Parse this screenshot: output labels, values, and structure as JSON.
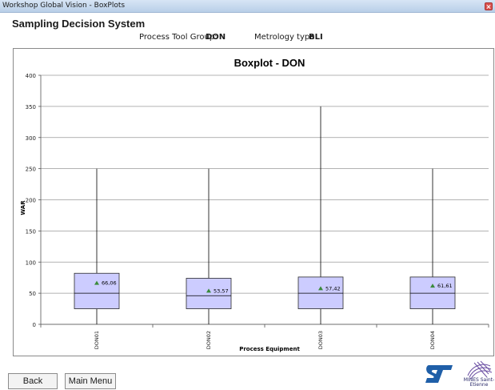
{
  "window": {
    "title": "Workshop Global Vision - BoxPlots"
  },
  "app": {
    "title": "Sampling Decision System"
  },
  "info": {
    "tool_group_label": "Process Tool Group:",
    "tool_group_value": "DON",
    "metrology_label": "Metrology type:",
    "metrology_value": "BLI"
  },
  "buttons": {
    "back": "Back",
    "main_menu": "Main Menu"
  },
  "logos": {
    "st": "ST",
    "mines": "MINES Saint-Etienne"
  },
  "colors": {
    "box_fill": "#ccccff",
    "mean_marker": "#3a8a3a",
    "grid": "#9a9a9a"
  },
  "chart_data": {
    "type": "boxplot",
    "title": "Boxplot - DON",
    "xlabel": "Process Equipment",
    "ylabel": "WAR",
    "ylim": [
      0,
      400
    ],
    "yticks": [
      0,
      50,
      100,
      150,
      200,
      250,
      300,
      350,
      400
    ],
    "grid": true,
    "categories": [
      "DON01",
      "DON02",
      "DON03",
      "DON04"
    ],
    "boxes": [
      {
        "category": "DON01",
        "min": 0,
        "q1": 25,
        "median": 50,
        "q3": 82,
        "max": 250,
        "mean": 66.06,
        "mean_label": "66,06"
      },
      {
        "category": "DON02",
        "min": 0,
        "q1": 25,
        "median": 46,
        "q3": 74,
        "max": 250,
        "mean": 53.57,
        "mean_label": "53,57"
      },
      {
        "category": "DON03",
        "min": 0,
        "q1": 25,
        "median": 50,
        "q3": 76,
        "max": 350,
        "mean": 57.42,
        "mean_label": "57,42"
      },
      {
        "category": "DON04",
        "min": 0,
        "q1": 25,
        "median": 50,
        "q3": 76,
        "max": 250,
        "mean": 61.61,
        "mean_label": "61,61"
      }
    ]
  }
}
